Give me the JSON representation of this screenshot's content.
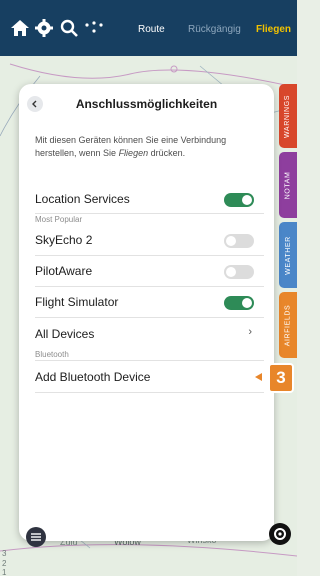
{
  "topbar": {
    "icons": [
      "home-icon",
      "settings-icon",
      "search-icon",
      "more-icon"
    ],
    "route_label": "Route",
    "undo_label": "Rückgängig",
    "fly_label": "Fliegen"
  },
  "side_tabs": [
    {
      "label": "WARNINGS",
      "color": "#d8472b"
    },
    {
      "label": "NOTAM",
      "color": "#8e3e9e"
    },
    {
      "label": "WEATHER",
      "color": "#4a86c8"
    },
    {
      "label": "AIRFIELDS",
      "color": "#e8862a"
    }
  ],
  "panel": {
    "title": "Anschlussmöglichkeiten",
    "description_before": "Mit diesen Geräten können Sie eine Verbindung herstellen, wenn Sie ",
    "description_emphasis": "Fliegen",
    "description_after": " drücken.",
    "location_services": {
      "label": "Location Services",
      "enabled": true
    },
    "section_most_popular": "Most Popular",
    "devices": [
      {
        "label": "SkyEcho 2",
        "enabled": false
      },
      {
        "label": "PilotAware",
        "enabled": false
      },
      {
        "label": "Flight Simulator",
        "enabled": true
      }
    ],
    "all_devices_label": "All Devices",
    "section_bluetooth": "Bluetooth",
    "add_bluetooth_label": "Add Bluetooth Device"
  },
  "callout_number": "3",
  "map": {
    "labels": [
      "Zulu",
      "Wolów",
      "Winsko"
    ],
    "scale_ticks": [
      "3",
      "2",
      "1"
    ]
  },
  "colors": {
    "topbar_bg": "#173f61",
    "accent": "#f2c200",
    "toggle_on": "#2e8b57",
    "callout": "#e8862a"
  }
}
